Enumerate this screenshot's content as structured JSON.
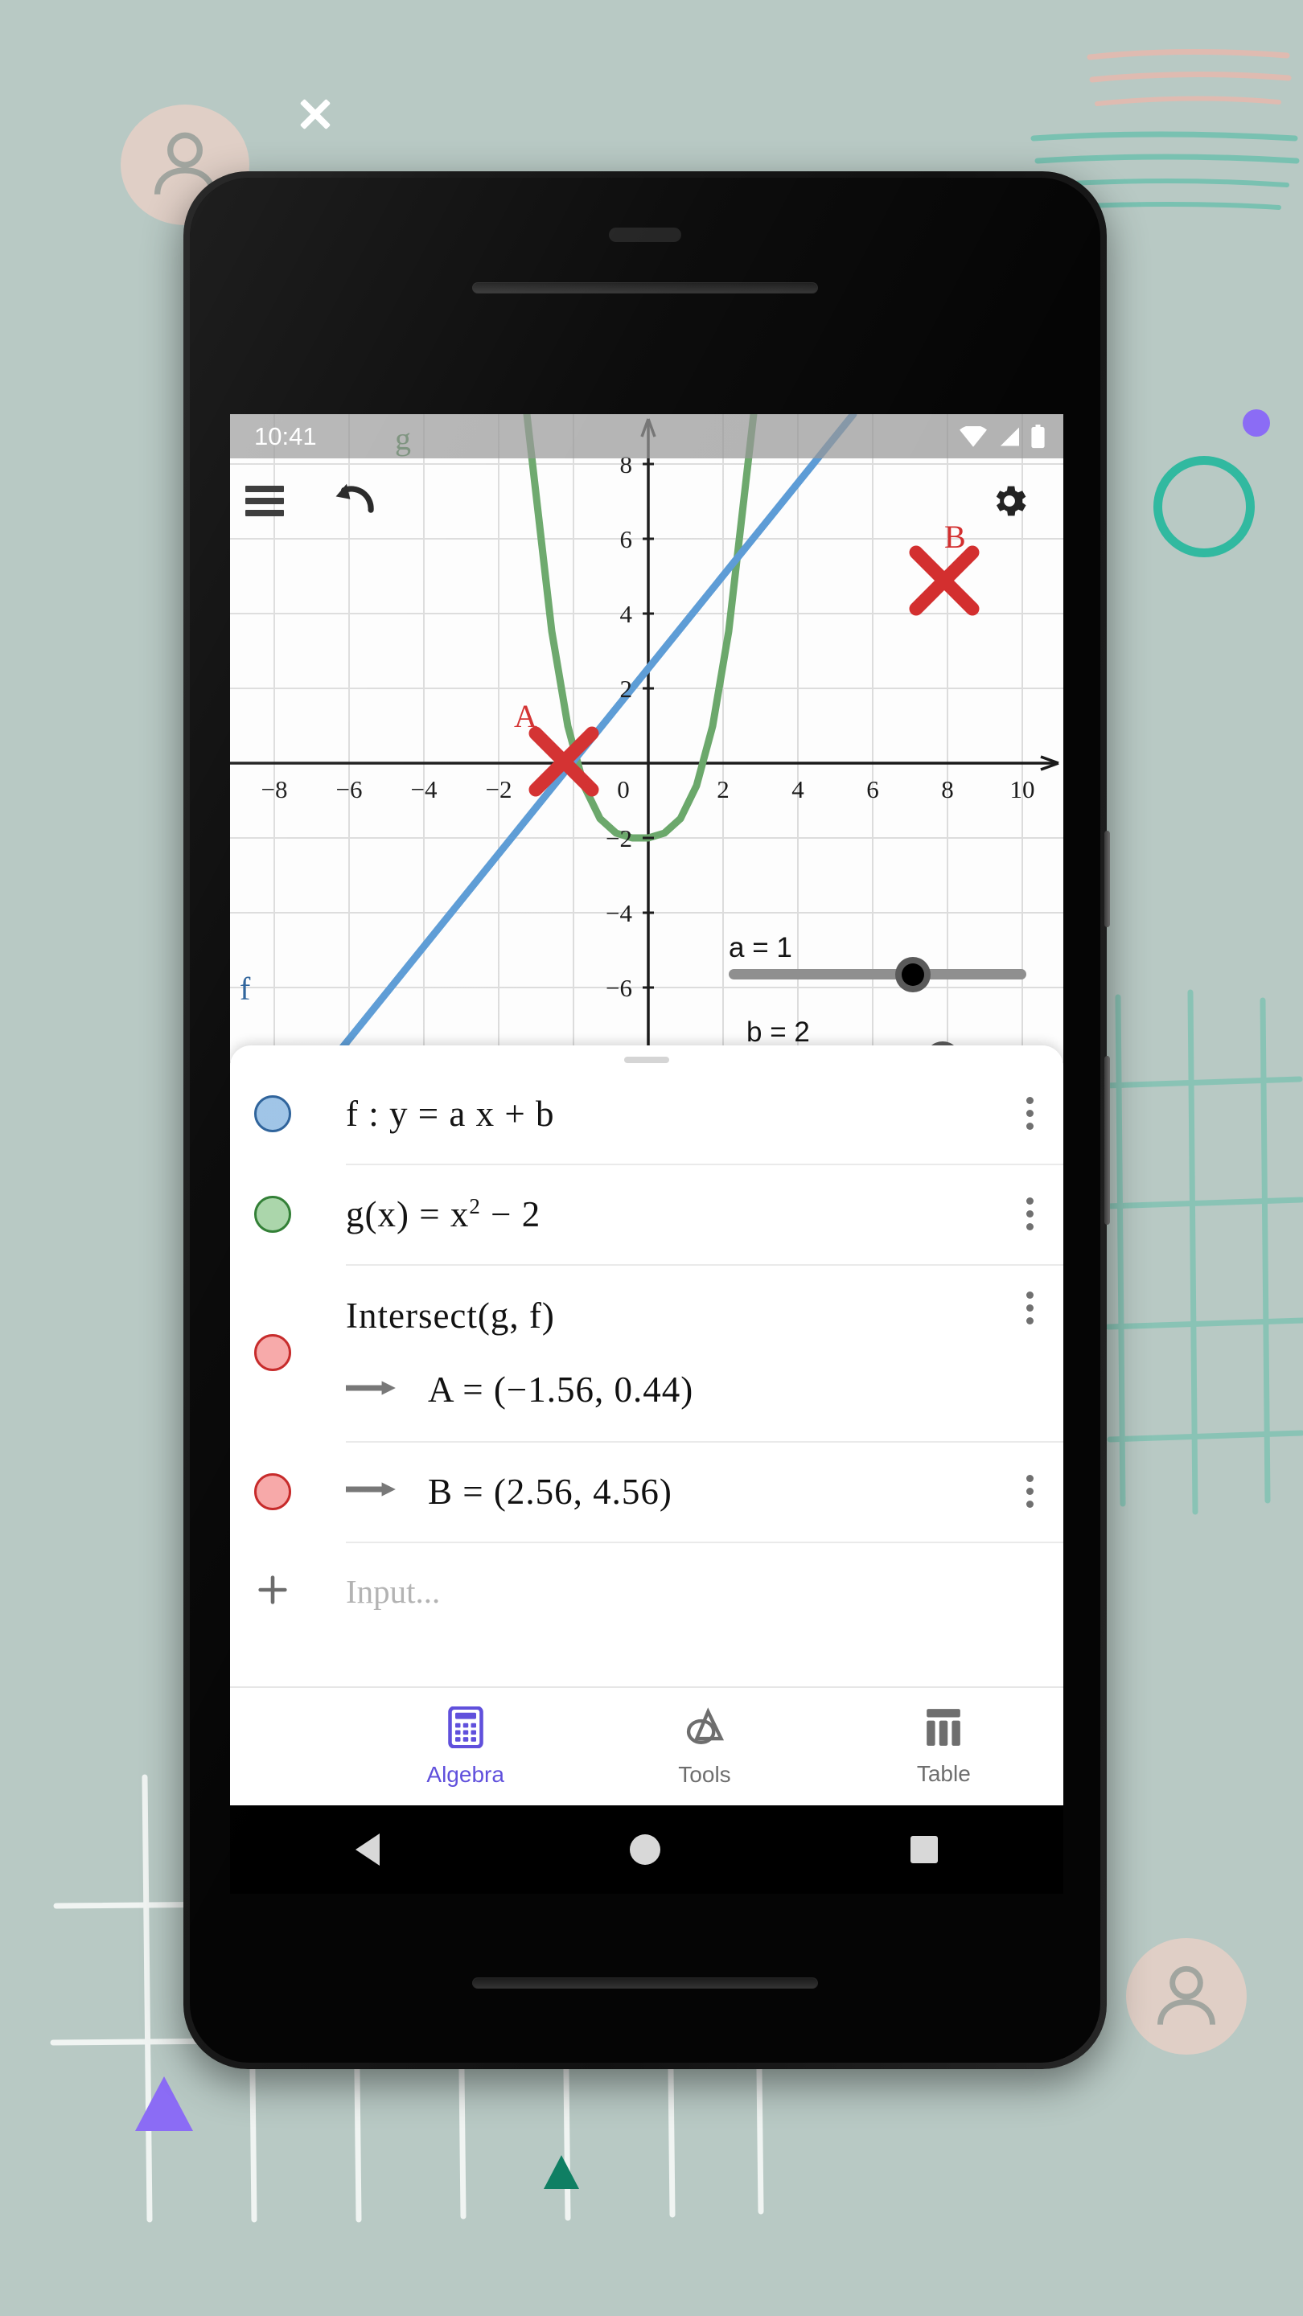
{
  "window": {
    "close_label": "×"
  },
  "phone": {
    "status_bar": {
      "time": "10:41",
      "icons": [
        "wifi-icon",
        "cell-signal-icon",
        "battery-icon"
      ]
    },
    "nav_bar": {
      "back": "back-triangle",
      "home": "home-circle",
      "recents": "recents-square"
    }
  },
  "appbar": {
    "menu_icon": "hamburger-menu-icon",
    "undo_icon": "undo-icon",
    "settings_icon": "gear-icon"
  },
  "chart_data": {
    "type": "line",
    "title": "",
    "xlabel": "",
    "ylabel": "",
    "xlim": [
      -9.6,
      11.2
    ],
    "ylim": [
      -7.0,
      9.2
    ],
    "grid": true,
    "xticks": [
      -8,
      -6,
      -4,
      -2,
      0,
      2,
      4,
      6,
      8,
      10
    ],
    "yticks": [
      8,
      6,
      4,
      2,
      0,
      -2,
      -4,
      -6
    ],
    "series": [
      {
        "name": "f",
        "label": "f",
        "expression": "y = a x + b",
        "a": 1,
        "b": 2,
        "color": "#5b9bd5",
        "kind": "line"
      },
      {
        "name": "g",
        "label": "g",
        "expression": "g(x) = x^2 - 2",
        "color": "#6aa76a",
        "kind": "parabola"
      }
    ],
    "points": [
      {
        "name": "A",
        "x": -1.56,
        "y": 0.44,
        "color": "#d32f2f",
        "marker": "x"
      },
      {
        "name": "B",
        "x": 2.56,
        "y": 4.56,
        "color": "#d32f2f",
        "marker": "x"
      }
    ]
  },
  "sliders": [
    {
      "name": "a",
      "label": "a = 1",
      "value": 1,
      "min": -5,
      "max": 5
    },
    {
      "name": "b",
      "label": "b = 2",
      "value": 2,
      "min": -5,
      "max": 5
    }
  ],
  "algebra": {
    "rows": [
      {
        "id": "f",
        "marble": "blue",
        "text": "f :  y  =  a x  +  b",
        "has_kebab": true
      },
      {
        "id": "g",
        "marble": "green",
        "text_pre": "g(x)  =  x",
        "text_sup": "2",
        "text_post": "  −  2",
        "has_kebab": true
      },
      {
        "id": "intersect",
        "marble": "red",
        "text": "Intersect(g, f)",
        "result": "A  =  (−1.56, 0.44)",
        "has_kebab": true
      },
      {
        "id": "pointB",
        "marble": "red",
        "result": "B  =  (2.56, 4.56)",
        "has_kebab": true
      }
    ],
    "input": {
      "placeholder": "Input...",
      "add_icon": "plus-icon"
    }
  },
  "tabs": [
    {
      "id": "algebra",
      "label": "Algebra",
      "icon": "calculator-icon",
      "active": true
    },
    {
      "id": "tools",
      "label": "Tools",
      "icon": "tools-icon",
      "active": false
    },
    {
      "id": "table",
      "label": "Table",
      "icon": "table-icon",
      "active": false
    }
  ],
  "colors": {
    "background": "#b8c9c4",
    "accent": "#6050dc",
    "line_blue": "#5b9bd5",
    "curve_green": "#6aa76a",
    "point_red": "#d32f2f",
    "teal_ring": "#31b9a0",
    "purple": "#8b6cf5"
  }
}
